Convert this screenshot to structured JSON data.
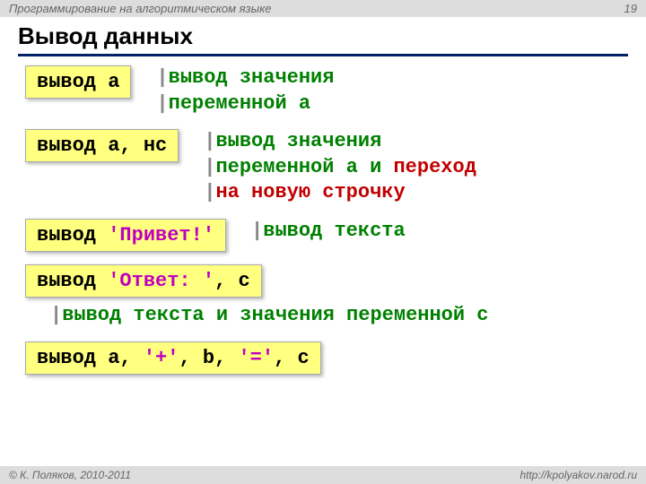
{
  "header": {
    "left": "Программирование на алгоритмическом языке",
    "page": "19"
  },
  "title": "Вывод данных",
  "ex1": {
    "kw": "вывод ",
    "var": "a",
    "c1a": "|",
    "c1b": "вывод значения",
    "c2a": "|",
    "c2b": "переменной a"
  },
  "ex2": {
    "kw": "вывод ",
    "rest": "a, нс",
    "c1a": "|",
    "c1b": "вывод значения",
    "c2a": "|",
    "c2b": "переменной a и ",
    "c2c": "переход",
    "c3a": "|",
    "c3b": "на новую строчку"
  },
  "ex3": {
    "kw": "вывод ",
    "lit": "'Привет!'",
    "ca": "|",
    "cb": "вывод текста"
  },
  "ex4": {
    "kw": "вывод ",
    "lit": "'Ответ: '",
    "rest": ", c",
    "ca": "|",
    "cb": "вывод текста и значения переменной c"
  },
  "ex5": {
    "kw": "вывод ",
    "p1": "a, ",
    "l1": "'+'",
    "p2": ", b, ",
    "l2": "'='",
    "p3": ", c"
  },
  "footer": {
    "left": "© К. Поляков, 2010-2011",
    "right": "http://kpolyakov.narod.ru"
  }
}
